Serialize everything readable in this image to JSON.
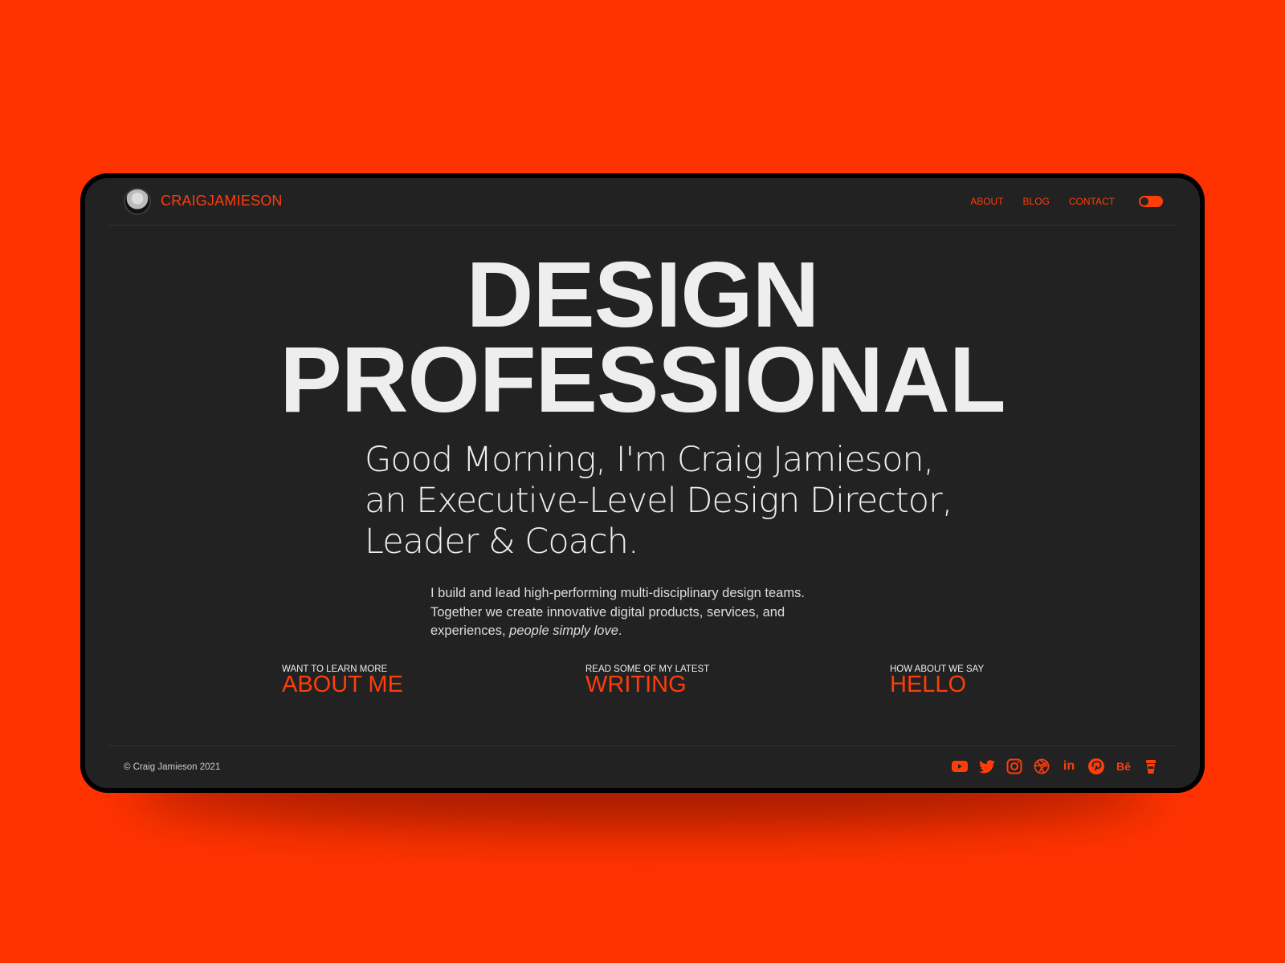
{
  "header": {
    "brand_first": "CRAIG",
    "brand_last": "JAMIESON",
    "nav": [
      "ABOUT",
      "BLOG",
      "CONTACT"
    ]
  },
  "hero": {
    "line1": "DESIGN",
    "line2": "PROFESSIONAL"
  },
  "intro": [
    "Good Morning, I'm Craig Jamieson,",
    "an Executive-Level Design Director,",
    "Leader & Coach."
  ],
  "para": {
    "text": "I build and lead high-performing multi-disciplinary design teams. Together we create innovative digital products, services, and experiences, ",
    "emph": "people simply love",
    "end": "."
  },
  "ctas": [
    {
      "small": "WANT TO LEARN MORE",
      "big": "ABOUT ME"
    },
    {
      "small": "READ SOME OF MY LATEST",
      "big": "WRITING"
    },
    {
      "small": "HOW ABOUT WE SAY",
      "big": "HELLO"
    }
  ],
  "footer": {
    "copyright": "© Craig Jamieson 2021",
    "socials": [
      "youtube-icon",
      "twitter-icon",
      "instagram-icon",
      "dribbble-icon",
      "linkedin-icon",
      "pinterest-icon",
      "behance-icon",
      "coffee-cup-icon"
    ],
    "linkedin_glyph": "in",
    "behance_glyph": "Bē"
  },
  "colors": {
    "accent": "#ff3d0a",
    "background": "#ff3300",
    "screen": "#222222"
  }
}
